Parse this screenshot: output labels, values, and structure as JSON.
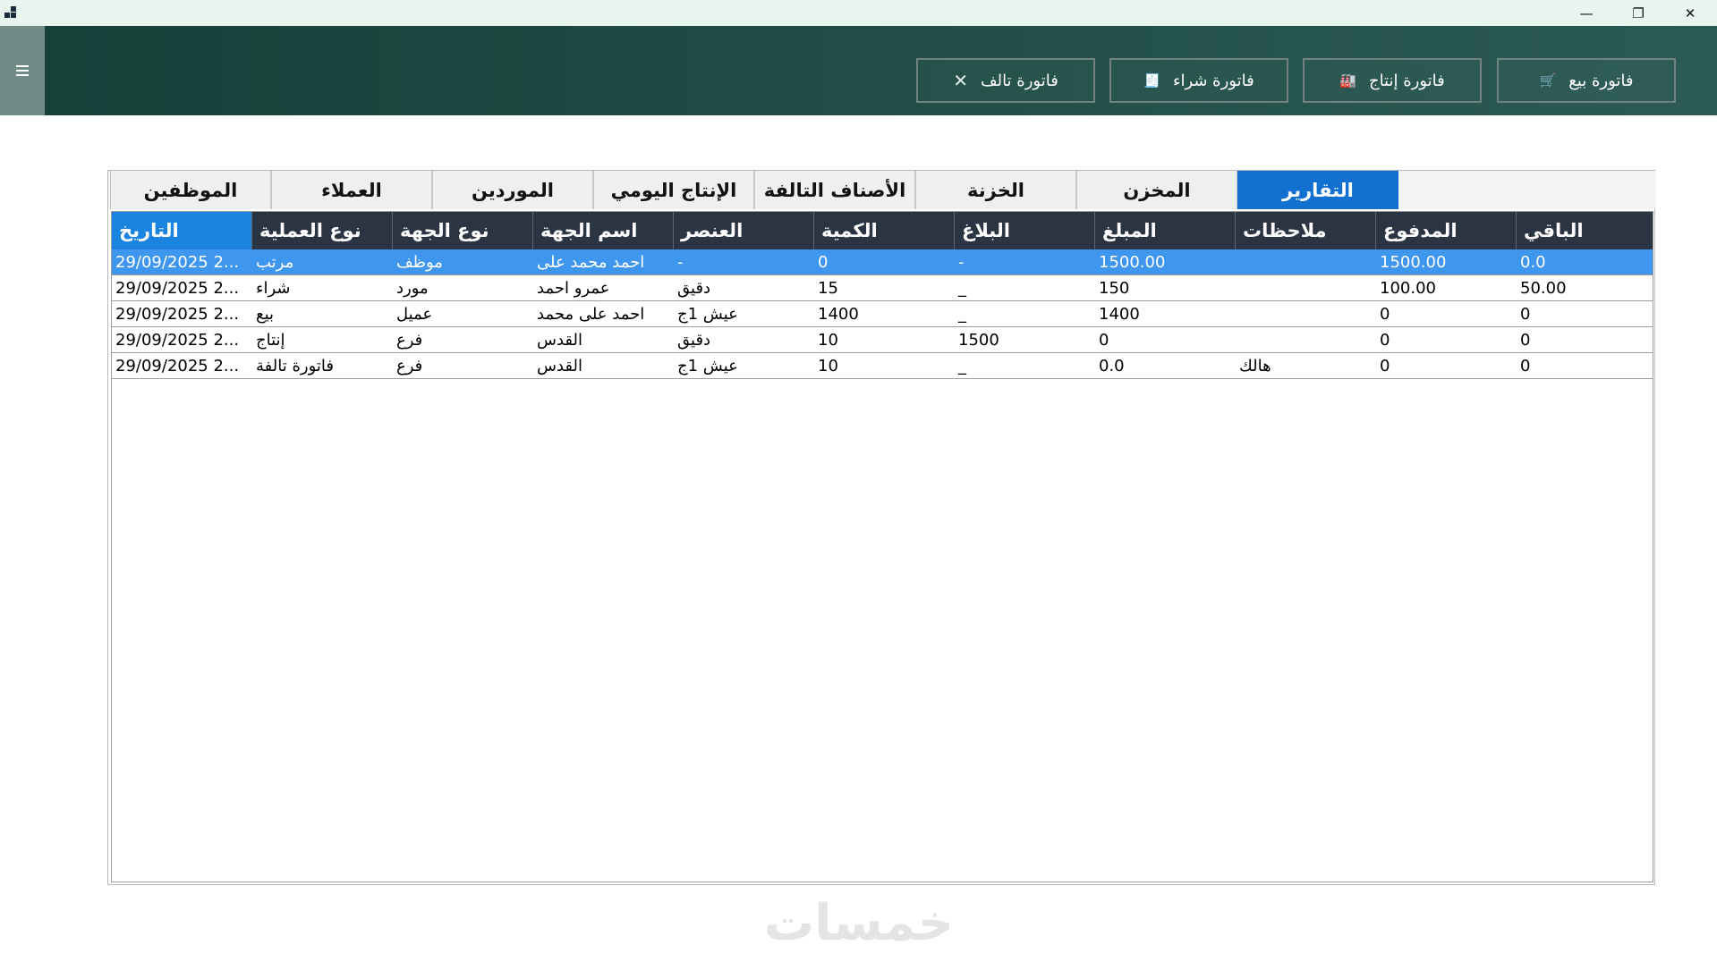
{
  "window": {
    "minimize_glyph": "—",
    "restore_glyph": "❐",
    "close_glyph": "✕"
  },
  "header": {
    "menu_icon": "hamburger-icon",
    "buttons": [
      {
        "label": "فاتورة بيع",
        "icon": "cart-icon",
        "glyph": "🛒"
      },
      {
        "label": "فاتورة إنتاج",
        "icon": "factory-icon",
        "glyph": "🏭"
      },
      {
        "label": "فاتورة شراء",
        "icon": "receipt-icon",
        "glyph": "🧾"
      },
      {
        "label": "فاتورة تالف",
        "icon": "close-icon",
        "glyph": "✕"
      }
    ]
  },
  "tabs": [
    {
      "label": "التقارير",
      "active": true
    },
    {
      "label": "المخزن",
      "active": false
    },
    {
      "label": "الخزنة",
      "active": false
    },
    {
      "label": "الأصناف التالفة",
      "active": false
    },
    {
      "label": "الإنتاج اليومي",
      "active": false
    },
    {
      "label": "الموردين",
      "active": false
    },
    {
      "label": "العملاء",
      "active": false
    },
    {
      "label": "الموظفين",
      "active": false
    }
  ],
  "grid": {
    "columns": [
      "التاريخ",
      "نوع العملية",
      "نوع الجهة",
      "اسم الجهة",
      "العنصر",
      "الكمية",
      "البلاغ",
      "المبلغ",
      "ملاحظات",
      "المدفوع",
      "الباقي"
    ],
    "rows": [
      [
        "29/09/2025 2...",
        "مرتب",
        "موظف",
        "احمد محمد على",
        "-",
        "0",
        "-",
        "1500.00",
        "",
        "1500.00",
        "0.0"
      ],
      [
        "29/09/2025 2...",
        "شراء",
        "مورد",
        "عمرو احمد",
        "دقيق",
        "15",
        "_",
        "150",
        "",
        "100.00",
        "50.00"
      ],
      [
        "29/09/2025 2...",
        "بيع",
        "عميل",
        "احمد على محمد",
        "عيش 1ج",
        "1400",
        "_",
        "1400",
        "",
        "0",
        "0"
      ],
      [
        "29/09/2025 2...",
        "إنتاج",
        "فرع",
        "القدس",
        "دقيق",
        "10",
        "1500",
        "0",
        "",
        "0",
        "0"
      ],
      [
        "29/09/2025 2...",
        "فاتورة تالفة",
        "فرع",
        "القدس",
        "عيش 1ج",
        "10",
        "_",
        "0.0",
        "هالك",
        "0",
        "0"
      ]
    ],
    "selected_row": 0
  },
  "watermark": "خمسات",
  "colors": {
    "header_bg": "#1f4c45",
    "tab_active": "#1270d0",
    "grid_header": "#2b3443",
    "row_selected": "#3f96ee"
  }
}
